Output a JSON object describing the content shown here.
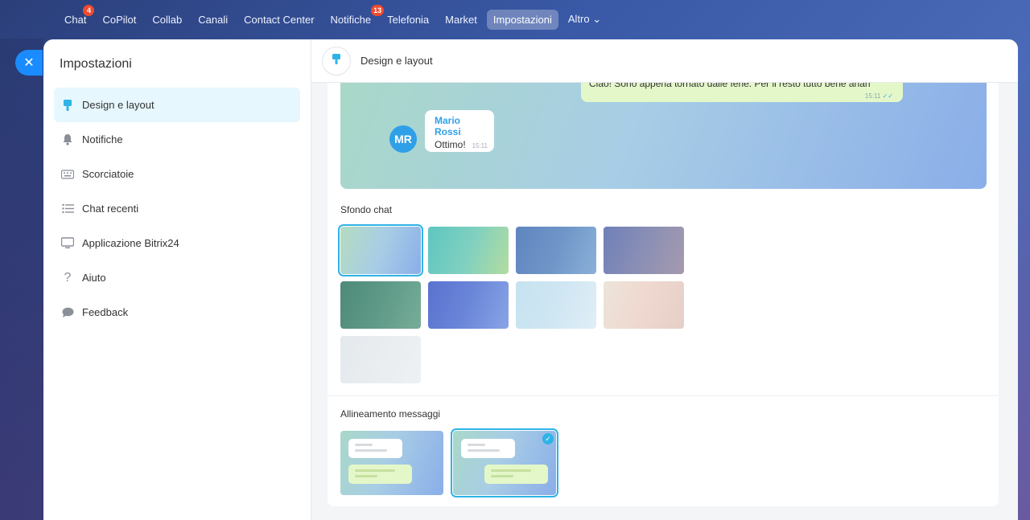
{
  "topnav": {
    "items": [
      {
        "label": "Chat",
        "badge": "4"
      },
      {
        "label": "CoPilot"
      },
      {
        "label": "Collab"
      },
      {
        "label": "Canali"
      },
      {
        "label": "Contact Center"
      },
      {
        "label": "Notifiche",
        "badge": "13"
      },
      {
        "label": "Telefonia"
      },
      {
        "label": "Market"
      },
      {
        "label": "Impostazioni",
        "active": true
      },
      {
        "label": "Altro ⌄"
      }
    ]
  },
  "sidebar": {
    "title": "Impostazioni",
    "items": [
      {
        "label": "Design e layout",
        "icon": "brush-icon",
        "active": true
      },
      {
        "label": "Notifiche",
        "icon": "bell-icon"
      },
      {
        "label": "Scorciatoie",
        "icon": "keyboard-icon"
      },
      {
        "label": "Chat recenti",
        "icon": "list-icon"
      },
      {
        "label": "Applicazione Bitrix24",
        "icon": "monitor-icon"
      },
      {
        "label": "Aiuto",
        "icon": "question-icon"
      },
      {
        "label": "Feedback",
        "icon": "chat-bubble-icon"
      }
    ]
  },
  "header": {
    "title": "Design e layout",
    "icon": "brush-icon"
  },
  "preview": {
    "outgoing_text": "Ciao! Sono appena tornato dalle ferie. Per il resto tutto bene ahah",
    "outgoing_time": "15:11",
    "avatar_initials": "MR",
    "incoming_name": "Mario Rossi",
    "incoming_text": "Ottimo!",
    "incoming_time": "15:11"
  },
  "backgrounds": {
    "title": "Sfondo chat",
    "selected_index": 0,
    "colors": [
      "#a9cfe6",
      "#7fd0c0",
      "#6f95c8",
      "#8a8fb5",
      "#5f9a88",
      "#6a86d8",
      "#cfe6f3",
      "#efd8cf",
      "#e9edf0"
    ]
  },
  "alignment": {
    "title": "Allineamento messaggi",
    "selected_index": 1
  },
  "colors": {
    "accent": "#2fb3e6",
    "close_button": "#1a8cff",
    "badge": "#ef4b2f"
  }
}
